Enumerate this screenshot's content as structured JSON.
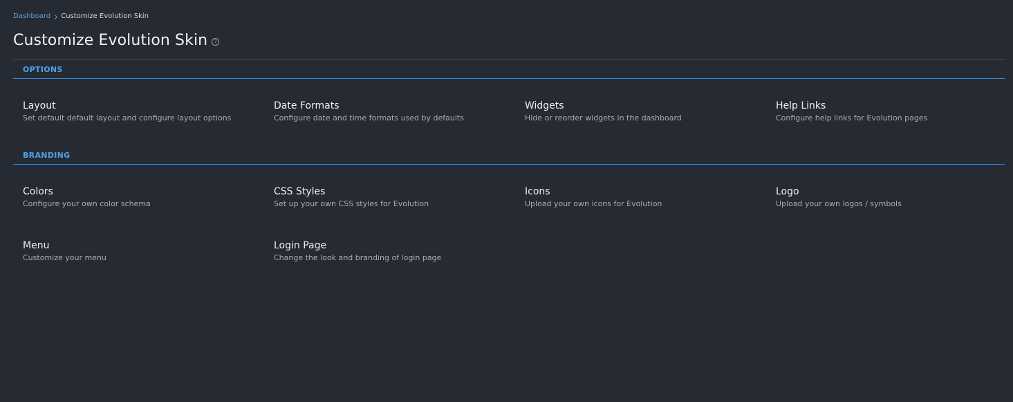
{
  "breadcrumb": {
    "home": "Dashboard",
    "current": "Customize Evolution Skin"
  },
  "page": {
    "title": "Customize Evolution Skin",
    "help_icon": "question-circle-icon"
  },
  "colors": {
    "background": "#262a33",
    "accent": "#2f8ae0",
    "link": "#4fa3e6"
  },
  "sections": [
    {
      "label": "OPTIONS",
      "items": [
        {
          "title": "Layout",
          "description": "Set default default layout and configure layout options"
        },
        {
          "title": "Date Formats",
          "description": "Configure date and time formats used by defaults"
        },
        {
          "title": "Widgets",
          "description": "Hide or reorder widgets in the dashboard"
        },
        {
          "title": "Help Links",
          "description": "Configure help links for Evolution pages"
        }
      ]
    },
    {
      "label": "BRANDING",
      "items": [
        {
          "title": "Colors",
          "description": "Configure your own color schema"
        },
        {
          "title": "CSS Styles",
          "description": "Set up your own CSS styles for Evolution"
        },
        {
          "title": "Icons",
          "description": "Upload your own icons for Evolution"
        },
        {
          "title": "Logo",
          "description": "Upload your own logos / symbols"
        },
        {
          "title": "Menu",
          "description": "Customize your menu"
        },
        {
          "title": "Login Page",
          "description": "Change the look and branding of login page"
        }
      ]
    }
  ]
}
